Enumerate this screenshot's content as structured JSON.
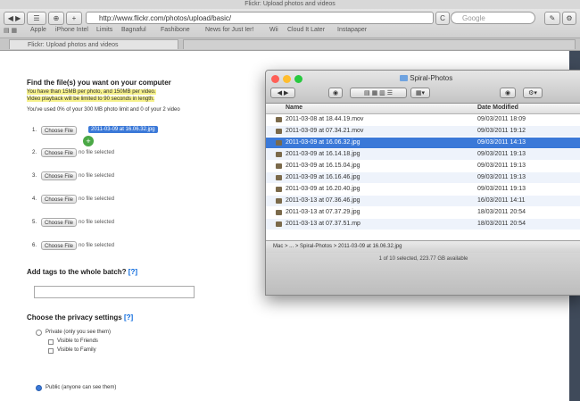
{
  "browser": {
    "window_title": "Flickr: Upload photos and videos",
    "url": "http://www.flickr.com/photos/upload/basic/",
    "search_placeholder": "Google",
    "bookmarks": [
      "Apple",
      "iPhone Intel",
      "Limits",
      "Bagnaful",
      "Fashibone",
      "News for Just Ier!",
      "Wii",
      "Cloud It Later",
      "Instapaper"
    ],
    "tab_label": "Flickr: Upload photos and videos"
  },
  "page": {
    "heading": "Find the file(s) you want on your computer",
    "limit_line1": "You have than 15MB per photo, and 150MB per video.",
    "limit_line2": "Video playback will be limited to 90 seconds in length.",
    "usage_line": "You've used 0% of your 300 MB photo limit and 0 of your 2 video",
    "rows": [
      {
        "n": "1.",
        "button": "Choose File",
        "status": "2011-03-09 at 16.06.32.jpg"
      },
      {
        "n": "2.",
        "button": "Choose File",
        "status": "no file selected"
      },
      {
        "n": "3.",
        "button": "Choose File",
        "status": "no file selected"
      },
      {
        "n": "4.",
        "button": "Choose File",
        "status": "no file selected"
      },
      {
        "n": "5.",
        "button": "Choose File",
        "status": "no file selected"
      },
      {
        "n": "6.",
        "button": "Choose File",
        "status": "no file selected"
      }
    ],
    "tags_heading": "Add tags to the whole batch?",
    "tags_help": "[?]",
    "privacy_heading": "Choose the privacy settings",
    "privacy_help": "[?]",
    "privacy_private": "Private (only you see them)",
    "privacy_friends": "Visible to Friends",
    "privacy_family": "Visible to Family",
    "privacy_public": "Public (anyone can see them)"
  },
  "finder": {
    "title": "Spiral-Photos",
    "col_name": "Name",
    "col_date": "Date Modified",
    "files": [
      {
        "name": "2011-03-08 at 18.44.19.mov",
        "date": "09/03/2011 18:09"
      },
      {
        "name": "2011-03-09 at 07.34.21.mov",
        "date": "09/03/2011 19:12"
      },
      {
        "name": "2011-03-09 at 16.06.32.jpg",
        "date": "09/03/2011 14:13"
      },
      {
        "name": "2011-03-09 at 16.14.18.jpg",
        "date": "09/03/2011 19:13"
      },
      {
        "name": "2011-03-09 at 16.15.04.jpg",
        "date": "09/03/2011 19:13"
      },
      {
        "name": "2011-03-09 at 16.16.46.jpg",
        "date": "09/03/2011 19:13"
      },
      {
        "name": "2011-03-09 at 16.20.40.jpg",
        "date": "09/03/2011 19:13"
      },
      {
        "name": "2011-03-13 at 07.36.46.jpg",
        "date": "16/03/2011 14:11"
      },
      {
        "name": "2011-03-13 at 07.37.29.jpg",
        "date": "18/03/2011 20:54"
      },
      {
        "name": "2011-03-13 at 07.37.51.mp",
        "date": "18/03/2011 20:54"
      }
    ],
    "selected_index": 2,
    "path": "Mac > ... > Spiral-Photos > 2011-03-09 at 16.06.32.jpg",
    "status": "1 of 10 selected, 223.77 GB available"
  }
}
